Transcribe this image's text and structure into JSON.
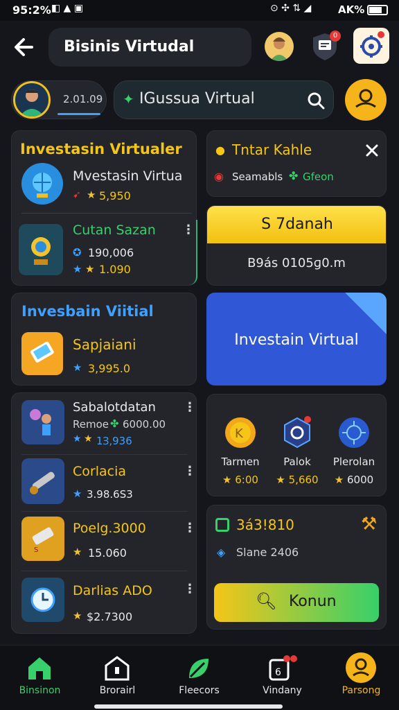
{
  "status_bar": {
    "time": "95:2%",
    "battery": "AK%"
  },
  "header": {
    "title": "Bisinis Virtudal",
    "notif_count": "0"
  },
  "profile": {
    "balance": "2.01.09"
  },
  "search": {
    "value": "IGussua Virtual"
  },
  "left_card1": {
    "title": "Investasin Virtualer",
    "item1": {
      "name": "Mvestasin Virtua",
      "value": "5,950"
    },
    "item2": {
      "name": "Cutan Sazan",
      "value1": "190,006",
      "value2": "1.090"
    }
  },
  "right_card1": {
    "title": "Tntar Kahle",
    "subtitle": "Seamabls",
    "subtitle_green": "Gfeon"
  },
  "yellow_card": {
    "label": "S 7danah",
    "sub": "B9ás 0105ɡ0.m"
  },
  "left_card2": {
    "title": "Invesbain Viitial",
    "item_name": "Sapjaiani",
    "item_value": "3,995.0"
  },
  "blue_card": {
    "label": "Investain Virtual"
  },
  "list": [
    {
      "name": "Sabalotdatan",
      "sub": "Remoe",
      "sub_value": "6000.00",
      "value": "1Ɜ,936"
    },
    {
      "name": "Corlacia",
      "value": "3.98.6S3"
    },
    {
      "name": "Poelg.3000",
      "value": "15.060"
    },
    {
      "name": "Darlias ADO",
      "value": "$2.7300"
    }
  ],
  "trio": [
    {
      "label": "Tarmen",
      "value": "6:00"
    },
    {
      "label": "Palok",
      "value": "5,660"
    },
    {
      "label": "Plerolan",
      "value": "6000"
    }
  ],
  "bottom_card": {
    "value": "3á3!810",
    "sub": "Slane 2406",
    "button": "Konun"
  },
  "nav": [
    {
      "label": "Binsinon"
    },
    {
      "label": "Brorairl"
    },
    {
      "label": "Fleecors"
    },
    {
      "label": "Vindany"
    },
    {
      "label": "Parsong"
    }
  ],
  "colors": {
    "accent_yellow": "#f5c518",
    "accent_green": "#37d06a",
    "blue_card": "#2f57d6"
  }
}
